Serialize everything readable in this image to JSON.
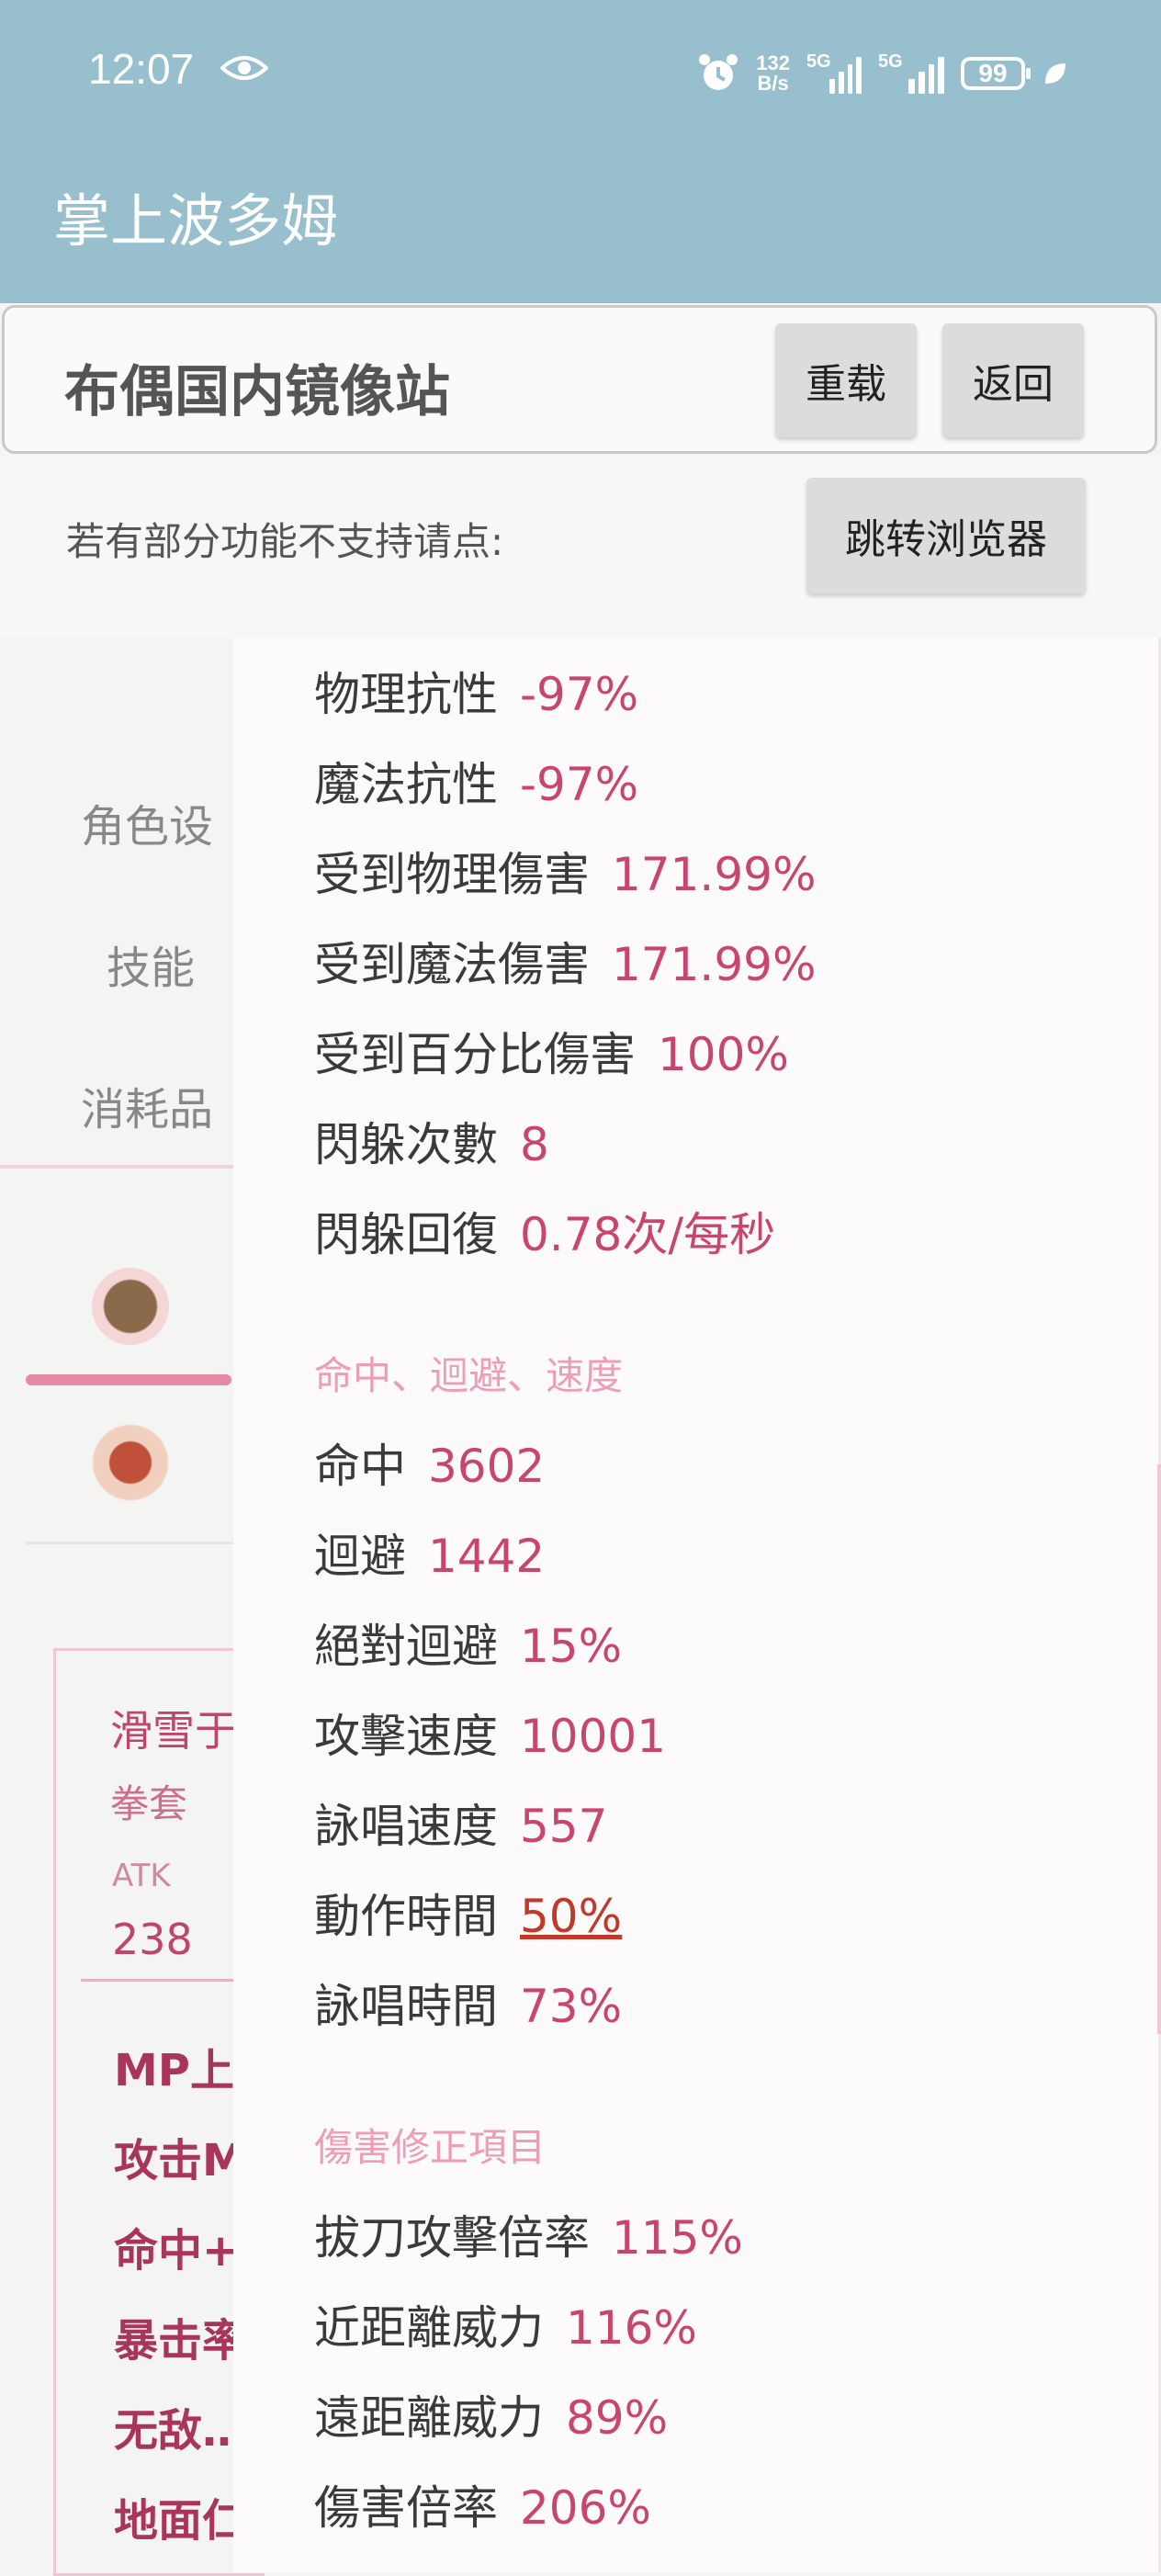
{
  "status_bar": {
    "time": "12:07",
    "net_speed_value": "132",
    "net_speed_unit": "B/s",
    "signal1_label": "5G",
    "signal2_label": "5G",
    "battery": "99"
  },
  "app_bar": {
    "title": "掌上波多姆"
  },
  "mirror_bar": {
    "title": "布偶国内镜像站",
    "reload_label": "重载",
    "back_label": "返回",
    "hint": "若有部分功能不支持请点:",
    "browser_label": "跳转浏览器"
  },
  "background_page": {
    "nav": [
      "角色设",
      "技能",
      "消耗品"
    ],
    "equip": {
      "name": "滑雪于",
      "type": "拳套",
      "atk_label": "ATK",
      "atk_value": "238",
      "stats": [
        "MP上",
        "攻击M",
        "命中+",
        "暴击率",
        "无敌‥",
        "地面仁"
      ]
    }
  },
  "stats_panel": {
    "rows_top": [
      {
        "label": "物理抗性",
        "value": "-97%"
      },
      {
        "label": "魔法抗性",
        "value": "-97%"
      },
      {
        "label": "受到物理傷害",
        "value": "171.99%"
      },
      {
        "label": "受到魔法傷害",
        "value": "171.99%"
      },
      {
        "label": "受到百分比傷害",
        "value": "100%"
      },
      {
        "label": "閃躲次數",
        "value": "8"
      },
      {
        "label": "閃躲回復",
        "value": "0.78次/每秒"
      }
    ],
    "section_speed": "命中、迴避、速度",
    "rows_speed": [
      {
        "label": "命中",
        "value": "3602"
      },
      {
        "label": "迴避",
        "value": "1442"
      },
      {
        "label": "絕對迴避",
        "value": "15%"
      },
      {
        "label": "攻擊速度",
        "value": "10001"
      },
      {
        "label": "詠唱速度",
        "value": "557"
      },
      {
        "label": "動作時間",
        "value": "50%"
      },
      {
        "label": "詠唱時間",
        "value": "73%"
      }
    ],
    "section_damage": "傷害修正項目",
    "rows_damage": [
      {
        "label": "拔刀攻擊倍率",
        "value": "115%"
      },
      {
        "label": "近距離威力",
        "value": "116%"
      },
      {
        "label": "遠距離威力",
        "value": "89%"
      },
      {
        "label": "傷害倍率",
        "value": "206%"
      }
    ]
  }
}
